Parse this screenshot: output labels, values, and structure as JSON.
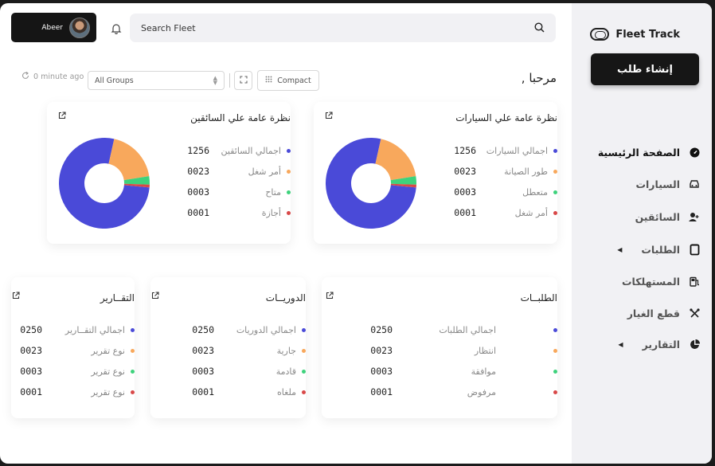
{
  "sidebar": {
    "brand": "Fleet Track",
    "create_button": "إنشاء طلب",
    "items": [
      {
        "label": "الصفحة الرئيسية"
      },
      {
        "label": "السيارات"
      },
      {
        "label": "السائقين"
      },
      {
        "label": "الطلبات"
      },
      {
        "label": "المستهلكات"
      },
      {
        "label": "قطع الغيار"
      },
      {
        "label": "التقارير"
      }
    ]
  },
  "header": {
    "user_name": "Abeer",
    "search_placeholder": "Search Fleet"
  },
  "toolbar": {
    "refresh_text": "0 minute ago",
    "groups_value": "All Groups",
    "compact_label": "Compact",
    "greeting": "مرحبا ,"
  },
  "colors": {
    "blue": "#4a4ad8",
    "orange": "#f8a85c",
    "green": "#3ed27c",
    "red": "#d84848"
  },
  "cards": {
    "vehicles": {
      "title": "نظرة عامة علي السيارات",
      "rows": [
        {
          "label": "اجمالي السيارات",
          "value": "1256"
        },
        {
          "label": "طور الصيانة",
          "value": "0023"
        },
        {
          "label": "متعطل",
          "value": "0003"
        },
        {
          "label": "أمر شغل",
          "value": "0001"
        }
      ]
    },
    "drivers": {
      "title": "نظرة عامة علي السائقين",
      "rows": [
        {
          "label": "اجمالي السائقين",
          "value": "1256"
        },
        {
          "label": "أمر شغل",
          "value": "0023"
        },
        {
          "label": "متاح",
          "value": "0003"
        },
        {
          "label": "أجازة",
          "value": "0001"
        }
      ]
    },
    "orders": {
      "title": "الطلبــات",
      "rows": [
        {
          "label": "اجمالي الطلبات",
          "value": "0250"
        },
        {
          "label": "انتظار",
          "value": "0023"
        },
        {
          "label": "موافقة",
          "value": "0003"
        },
        {
          "label": "مرفوض",
          "value": "0001"
        }
      ]
    },
    "patrols": {
      "title": "الدوريــات",
      "rows": [
        {
          "label": "اجمالي الدوريات",
          "value": "0250"
        },
        {
          "label": "جارية",
          "value": "0023"
        },
        {
          "label": "قادمة",
          "value": "0003"
        },
        {
          "label": "ملغاه",
          "value": "0001"
        }
      ]
    },
    "reports": {
      "title": "التقــارير",
      "rows": [
        {
          "label": "اجمالي التقــارير",
          "value": "0250"
        },
        {
          "label": "نوع تقرير",
          "value": "0023"
        },
        {
          "label": "نوع تقرير",
          "value": "0003"
        },
        {
          "label": "نوع تقرير",
          "value": "0001"
        }
      ]
    }
  },
  "chart_data": [
    {
      "type": "pie",
      "categories": [
        "اجمالي السيارات",
        "طور الصيانة",
        "متعطل",
        "أمر شغل"
      ],
      "values": [
        77,
        19,
        3,
        1
      ]
    },
    {
      "type": "pie",
      "categories": [
        "اجمالي السائقين",
        "أمر شغل",
        "متاح",
        "أجازة"
      ],
      "values": [
        77,
        19,
        3,
        1
      ]
    }
  ]
}
